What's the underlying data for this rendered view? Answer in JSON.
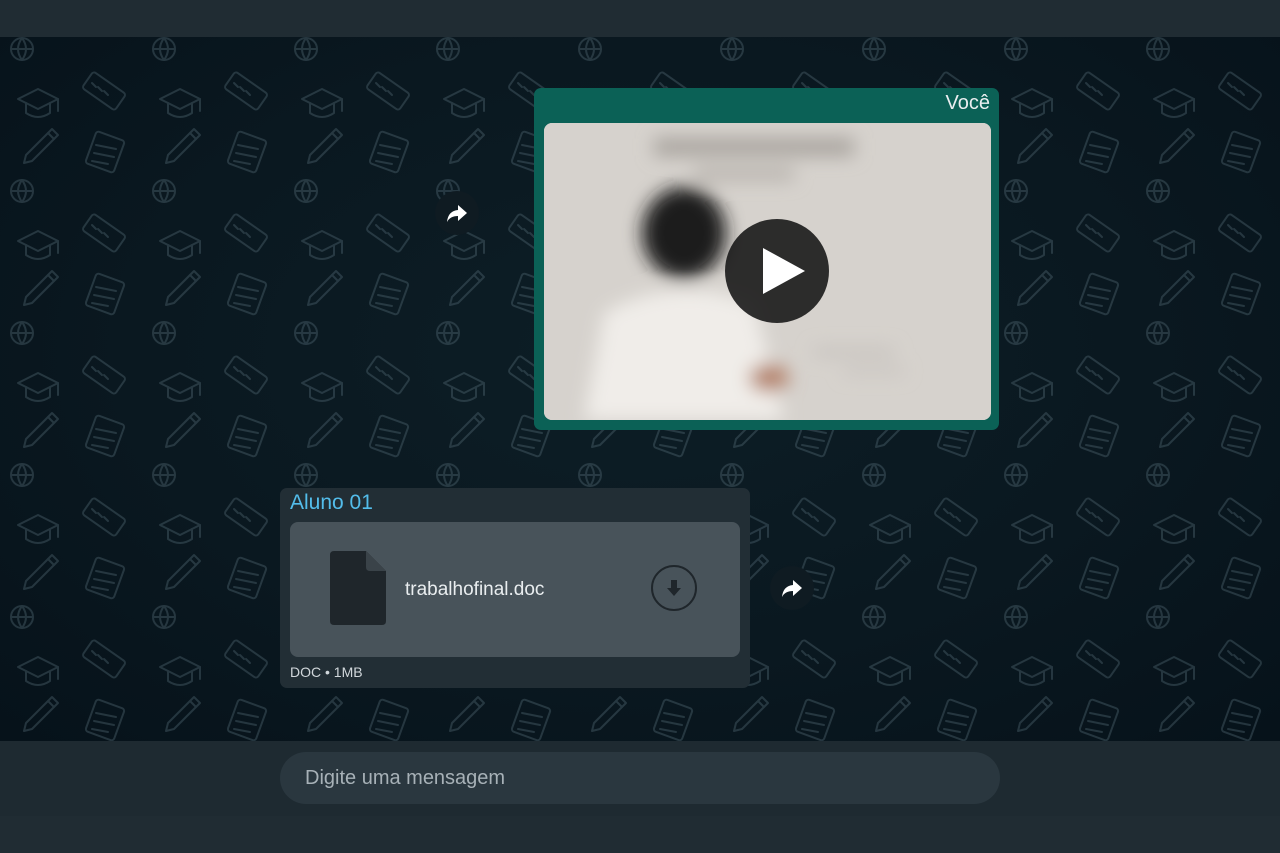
{
  "chat": {
    "outgoing_video": {
      "sender": "Você"
    },
    "incoming_document": {
      "sender": "Aluno 01",
      "file_name": "trabalhofinal.doc",
      "meta": "DOC • 1MB"
    }
  },
  "composer": {
    "placeholder": "Digite uma mensagem"
  },
  "icons": {
    "forward": "forward-arrow-icon",
    "play": "play-icon",
    "document": "document-file-icon",
    "download": "download-arrow-icon"
  },
  "colors": {
    "outgoing_bubble": "#0b6156",
    "incoming_bubble": "#222e35",
    "sender_name_incoming": "#53bdeb",
    "chat_background": "#0a1820",
    "composer_input": "#2a373f"
  }
}
